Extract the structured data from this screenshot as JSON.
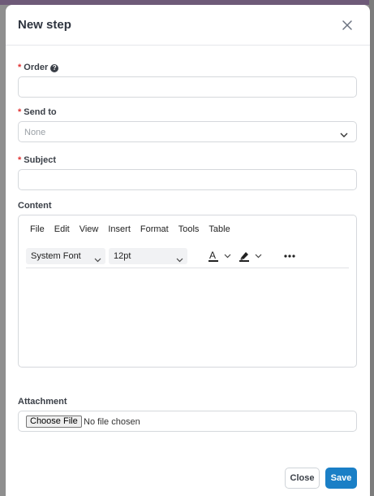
{
  "modal": {
    "title": "New step"
  },
  "fields": {
    "order": {
      "label": "Order",
      "required_mark": "*",
      "help_icon": "?",
      "value": ""
    },
    "send_to": {
      "label": "Send to",
      "required_mark": "*",
      "selected": "None"
    },
    "subject": {
      "label": "Subject",
      "required_mark": "*",
      "value": ""
    },
    "content": {
      "label": "Content"
    },
    "attachment": {
      "label": "Attachment",
      "button_label": "Choose File",
      "status": "No file chosen"
    }
  },
  "editor": {
    "menu": [
      "File",
      "Edit",
      "View",
      "Insert",
      "Format",
      "Tools",
      "Table"
    ],
    "font_family": "System Font",
    "font_size": "12pt",
    "text_color_letter": "A",
    "icons": {
      "text_color": "text-color-icon",
      "highlight": "highlighter-icon",
      "more": "more-icon"
    }
  },
  "footer": {
    "close_label": "Close",
    "save_label": "Save"
  },
  "colors": {
    "primary": "#1a7fc6",
    "required": "#e03131",
    "overlay": "#8f8f8f"
  }
}
